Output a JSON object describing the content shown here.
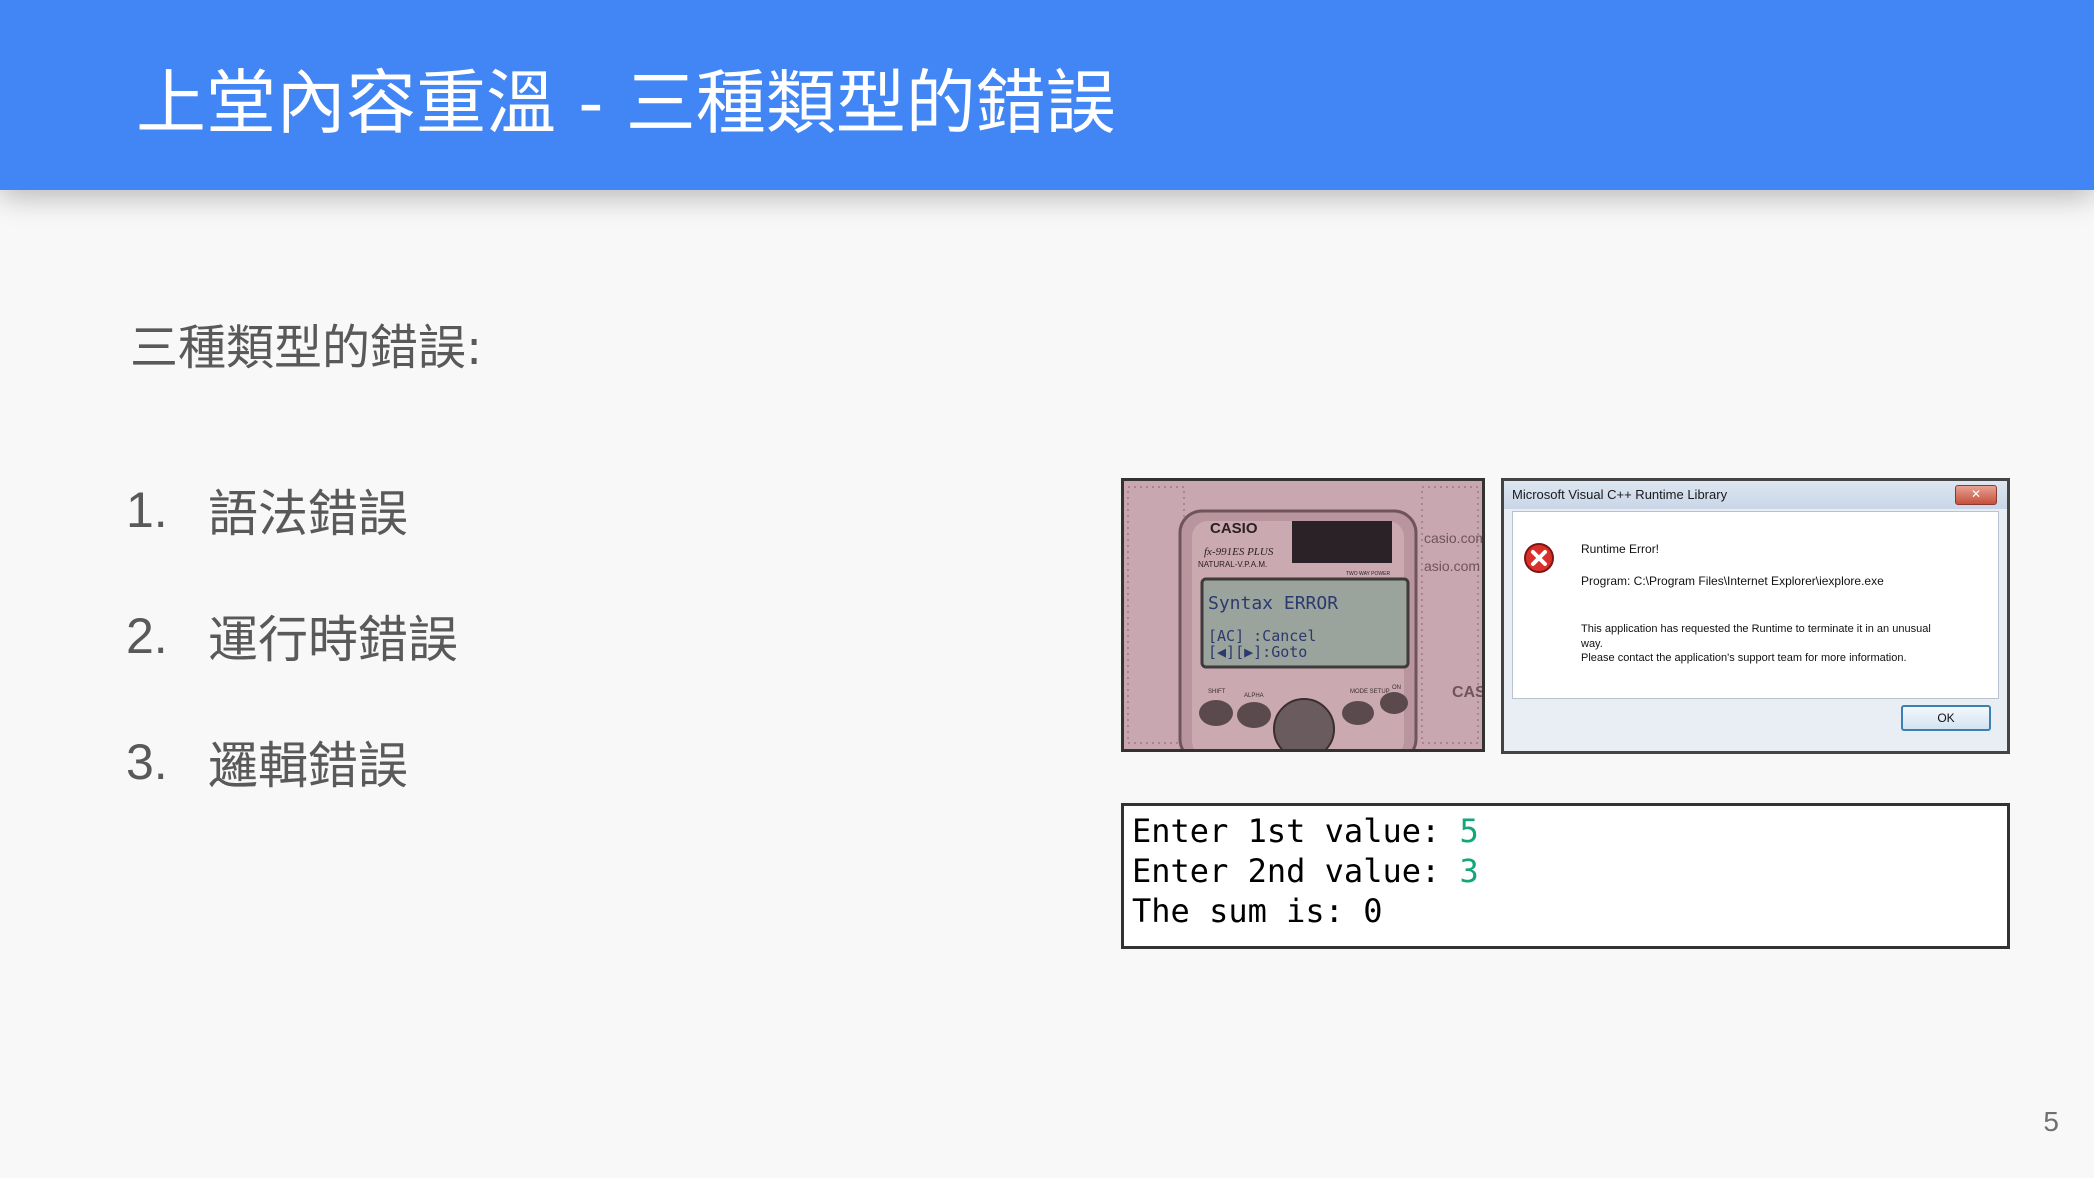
{
  "header": {
    "title": "上堂內容重溫 - 三種類型的錯誤"
  },
  "subtitle": "三種類型的錯誤:",
  "list": [
    {
      "num": "1.",
      "label": "語法錯誤"
    },
    {
      "num": "2.",
      "label": "運行時錯誤"
    },
    {
      "num": "3.",
      "label": "邏輯錯誤"
    }
  ],
  "calculator": {
    "brand": "CASIO",
    "model": "fx-991ES PLUS",
    "sub": "NATURAL-V.P.A.M.",
    "power": "TWO WAY POWER",
    "screen_line1": "Syntax ERROR",
    "screen_line2": "[AC]  :Cancel",
    "screen_line3": "[◀][▶]:Goto",
    "keys": {
      "shift": "SHIFT",
      "alpha": "ALPHA",
      "mode": "MODE SETUP",
      "on": "ON"
    },
    "side_text": [
      "casio.com",
      "asio.com",
      "CAS"
    ]
  },
  "dialog": {
    "title": "Microsoft Visual C++ Runtime Library",
    "close": "✕",
    "heading": "Runtime Error!",
    "program": "Program: C:\\Program Files\\Internet Explorer\\iexplore.exe",
    "message1": "This application has requested the Runtime to terminate it in an unusual way.",
    "message2": "Please contact the application's support team for more information.",
    "ok": "OK"
  },
  "console": {
    "lines": [
      {
        "prompt": "Enter 1st value: ",
        "value": "5"
      },
      {
        "prompt": "Enter 2nd value: ",
        "value": "3"
      },
      {
        "prompt": "The sum is: ",
        "value": "0"
      }
    ],
    "colors": {
      "input": "#13a67a"
    }
  },
  "page_number": "5",
  "colors": {
    "header": "#4285f4",
    "body_text": "#595959",
    "background": "#f8f8f8"
  }
}
